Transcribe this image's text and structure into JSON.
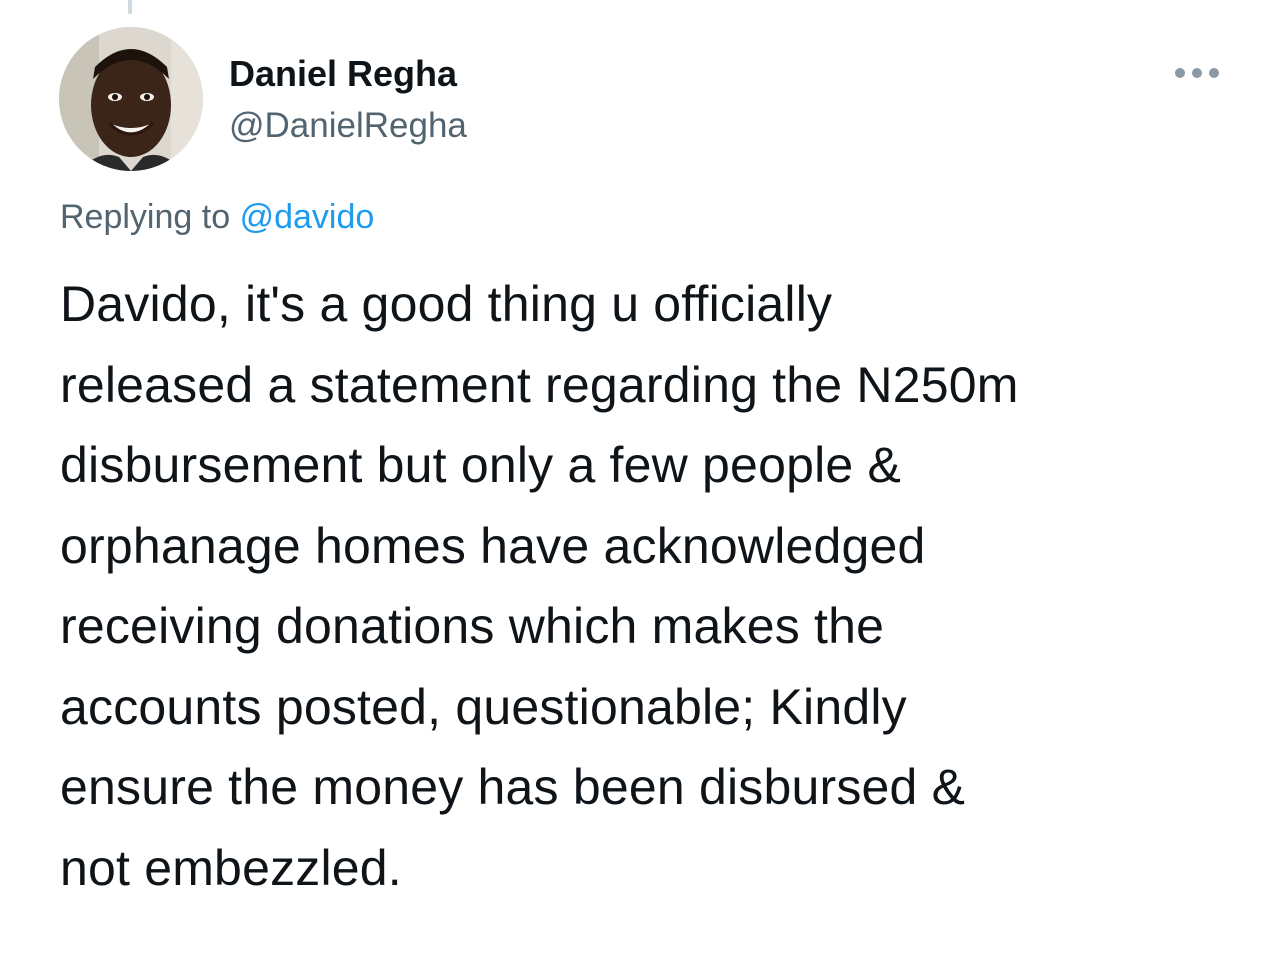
{
  "tweet": {
    "author": {
      "display_name": "Daniel Regha",
      "handle": "@DanielRegha",
      "avatar_icon": "profile-photo"
    },
    "more_icon": "more-horizontal-icon",
    "reply_prefix": "Replying to",
    "reply_mention": "@davido",
    "text_lines": [
      "Davido, it's a good thing u officially",
      "released a statement regarding the N250m",
      "disbursement but only a few people &",
      "orphanage homes have acknowledged",
      "receiving donations which makes the",
      "accounts posted, questionable; Kindly",
      "ensure the money has been disbursed &",
      "not embezzled."
    ]
  },
  "colors": {
    "text_primary": "#0f1419",
    "text_secondary": "#536471",
    "link": "#1d9bf0",
    "thread_line": "#cfd9de"
  }
}
